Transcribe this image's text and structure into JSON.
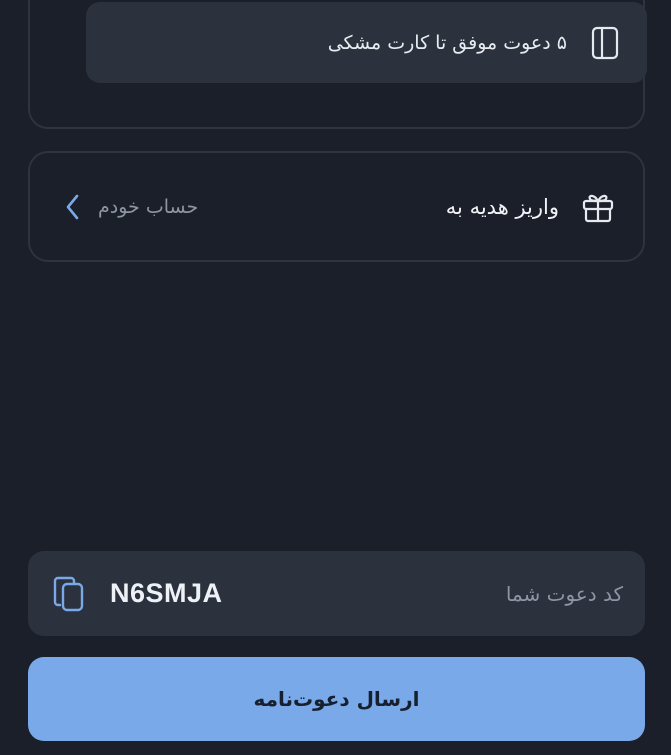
{
  "milestone": {
    "text": "۵ دعوت موفق تا کارت مشکی",
    "icon": "card-icon"
  },
  "gift": {
    "label": "واریز هدیه به",
    "destination": "حساب خودم",
    "icon": "gift-icon",
    "chevron_icon": "chevron-left-icon"
  },
  "invite": {
    "code_label": "کد دعوت شما",
    "code_value": "N6SMJA",
    "copy_icon": "copy-icon"
  },
  "send_button": {
    "label": "ارسال دعوت‌نامه"
  },
  "colors": {
    "background": "#1b1f29",
    "card": "#2b313d",
    "border": "#2d3340",
    "accent": "#79a9e9"
  }
}
